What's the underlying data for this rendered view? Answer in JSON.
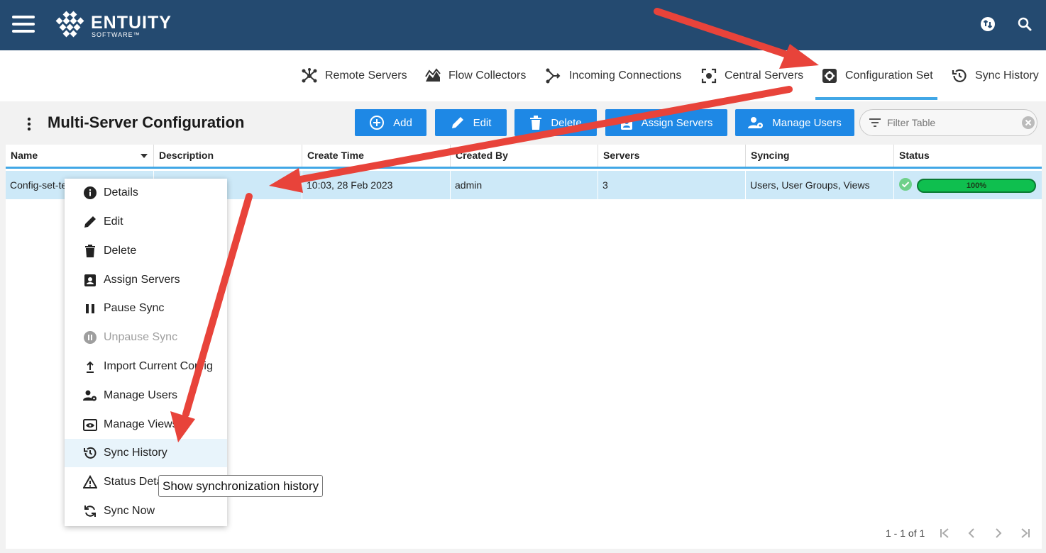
{
  "brand": {
    "name": "ENTUITY",
    "sub": "SOFTWARE™"
  },
  "header_icons": [
    "sync-status-icon",
    "search-icon"
  ],
  "tabs": [
    {
      "label": "Remote Servers",
      "icon": "network-icon"
    },
    {
      "label": "Flow Collectors",
      "icon": "area-chart-icon"
    },
    {
      "label": "Incoming Connections",
      "icon": "branch-arrow-icon"
    },
    {
      "label": "Central Servers",
      "icon": "focus-target-icon"
    },
    {
      "label": "Configuration Set",
      "icon": "gear-box-icon",
      "active": true
    },
    {
      "label": "Sync History",
      "icon": "history-icon"
    }
  ],
  "page": {
    "title": "Multi-Server Configuration",
    "buttons": {
      "add": "Add",
      "edit": "Edit",
      "delete": "Delete",
      "assign": "Assign Servers",
      "manage": "Manage Users"
    },
    "filter_placeholder": "Filter Table"
  },
  "table": {
    "columns": [
      "Name",
      "Description",
      "Create Time",
      "Created By",
      "Servers",
      "Syncing",
      "Status"
    ],
    "rows": [
      {
        "name": "Config-set-te",
        "description": "",
        "create_time": "10:03, 28 Feb 2023",
        "created_by": "admin",
        "servers": "3",
        "syncing": "Users, User Groups, Views",
        "status_percent": "100%"
      }
    ],
    "pager": "1 - 1 of 1"
  },
  "context_menu": [
    {
      "label": "Details",
      "icon": "info-icon"
    },
    {
      "label": "Edit",
      "icon": "pencil-icon"
    },
    {
      "label": "Delete",
      "icon": "trash-icon"
    },
    {
      "label": "Assign Servers",
      "icon": "clipboard-user-icon"
    },
    {
      "label": "Pause Sync",
      "icon": "pause-icon"
    },
    {
      "label": "Unpause Sync",
      "icon": "pause-circle-icon",
      "disabled": true
    },
    {
      "label": "Import Current Config",
      "icon": "upload-icon"
    },
    {
      "label": "Manage Users",
      "icon": "user-gear-icon"
    },
    {
      "label": "Manage Views",
      "icon": "eye-window-icon"
    },
    {
      "label": "Sync History",
      "icon": "history-icon",
      "hover": true
    },
    {
      "label": "Status Deta",
      "icon": "warning-icon"
    },
    {
      "label": "Sync Now",
      "icon": "sync-icon"
    }
  ],
  "tooltip": "Show synchronization history",
  "colors": {
    "header": "#244a70",
    "accent": "#41a7e6",
    "button": "#1e88e5",
    "selected_row": "#cde9f8",
    "arrow": "#e8433a",
    "progress": "#0fbf4f"
  }
}
